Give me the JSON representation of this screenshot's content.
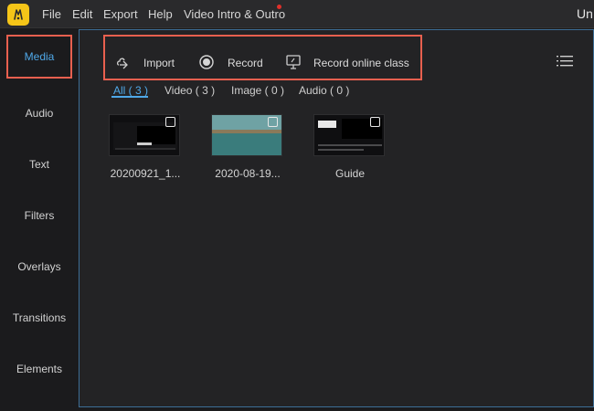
{
  "menubar": {
    "items": [
      "File",
      "Edit",
      "Export",
      "Help",
      "Video Intro & Outro"
    ],
    "title": "Un"
  },
  "sidebar": {
    "items": [
      "Media",
      "Audio",
      "Text",
      "Filters",
      "Overlays",
      "Transitions",
      "Elements"
    ]
  },
  "toolbar": {
    "import_label": "Import",
    "record_label": "Record",
    "online_label": "Record online class"
  },
  "filters": {
    "all": "All ( 3 )",
    "video": "Video ( 3 )",
    "image": "Image ( 0 )",
    "audio": "Audio ( 0 )"
  },
  "media_items": [
    {
      "label": "20200921_1..."
    },
    {
      "label": "2020-08-19..."
    },
    {
      "label": "Guide"
    }
  ],
  "colors": {
    "accent": "#4fa8e8",
    "highlight": "#e8604f",
    "logo": "#f5c518"
  }
}
